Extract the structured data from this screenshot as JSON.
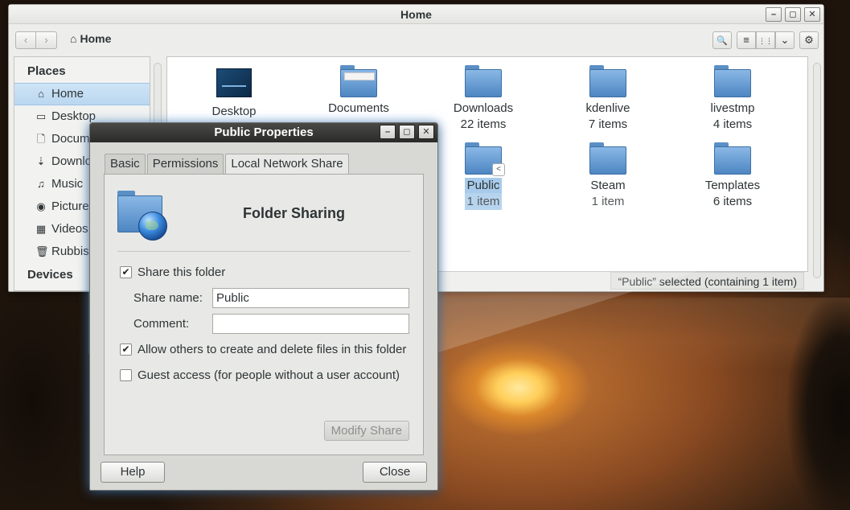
{
  "main_window": {
    "title": "Home",
    "wm": {
      "minimize": "–",
      "maximize": "◻",
      "close": "✕"
    },
    "toolbar": {
      "back": "‹",
      "forward": "›",
      "path_label": "Home",
      "search": "🔍",
      "list_view": "≡",
      "grid_view": "⋮⋮",
      "view_menu": "⌄",
      "settings": "⚙"
    },
    "sidebar": {
      "places_heading": "Places",
      "devices_heading": "Devices",
      "items": [
        {
          "label": "Home",
          "icon": "⌂"
        },
        {
          "label": "Desktop",
          "icon": "▭"
        },
        {
          "label": "Documents",
          "icon": "🗋"
        },
        {
          "label": "Downloads",
          "icon": "⇣"
        },
        {
          "label": "Music",
          "icon": "♫"
        },
        {
          "label": "Pictures",
          "icon": "◉"
        },
        {
          "label": "Videos",
          "icon": "▦"
        },
        {
          "label": "Rubbish Bin",
          "icon": "🗑"
        }
      ]
    },
    "files": [
      {
        "name": "Desktop",
        "count": ""
      },
      {
        "name": "Documents",
        "count": ""
      },
      {
        "name": "Downloads",
        "count": "22 items"
      },
      {
        "name": "kdenlive",
        "count": "7 items"
      },
      {
        "name": "livestmp",
        "count": "4 items"
      },
      {
        "name": "Public",
        "count": "1 item"
      },
      {
        "name": "Steam",
        "count": "1 item"
      },
      {
        "name": "Templates",
        "count": "6 items"
      }
    ],
    "status": "“Public” selected (containing 1 item)"
  },
  "dialog": {
    "title": "Public Properties",
    "tabs": [
      "Basic",
      "Permissions",
      "Local Network Share"
    ],
    "panel_title": "Folder Sharing",
    "share_checkbox": {
      "label": "Share this folder",
      "checked": "✔"
    },
    "share_name_label": "Share name:",
    "share_name_value": "Public",
    "comment_label": "Comment:",
    "comment_value": "",
    "allow_checkbox": {
      "label": "Allow others to create and delete files in this folder",
      "checked": "✔"
    },
    "guest_checkbox": {
      "label": "Guest access (for people without a user account)",
      "checked": ""
    },
    "modify_button": "Modify Share",
    "help_button": "Help",
    "close_button": "Close"
  }
}
